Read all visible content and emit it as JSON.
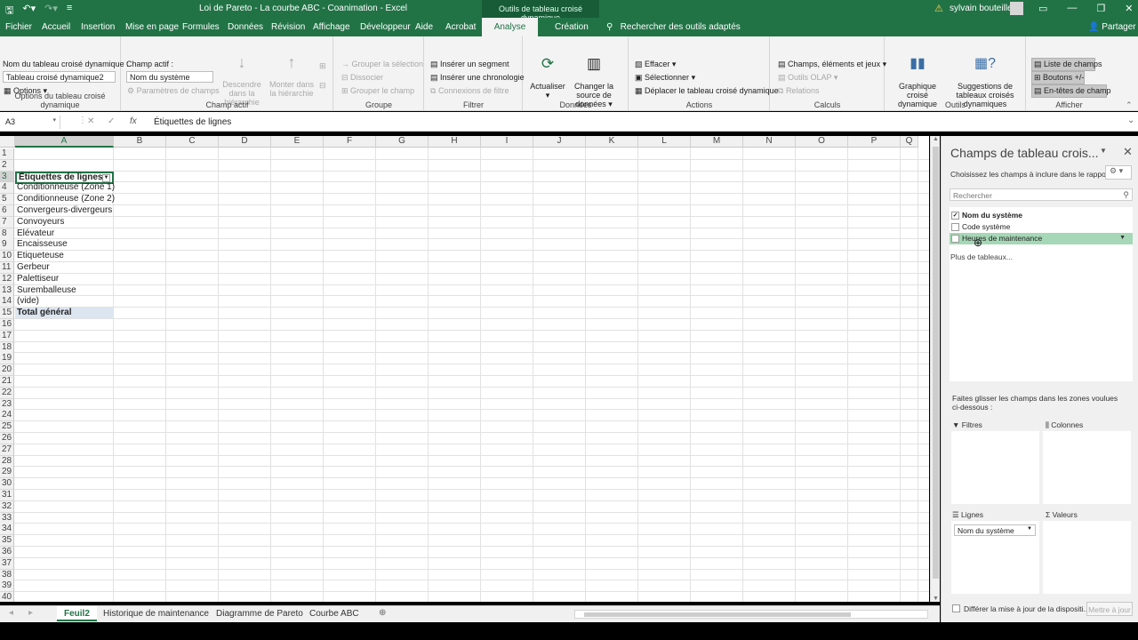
{
  "window": {
    "title": "Loi de Pareto - La courbe ABC - Coanimation  -  Excel",
    "context_title": "Outils de tableau croisé dynamique",
    "user": "sylvain bouteiller"
  },
  "tabs": [
    "Fichier",
    "Accueil",
    "Insertion",
    "Mise en page",
    "Formules",
    "Données",
    "Révision",
    "Affichage",
    "Développeur",
    "Aide",
    "Acrobat",
    "Analyse",
    "Création"
  ],
  "active_tab": "Analyse",
  "tell_me": "Rechercher des outils adaptés",
  "share": "Partager",
  "ribbon": {
    "pivot_options": {
      "name_label": "Nom du tableau croisé dynamique :",
      "name_value": "Tableau croisé dynamique2",
      "options_label": "Options",
      "group_label": "Options du tableau croisé dynamique"
    },
    "active_field": {
      "label": "Champ actif :",
      "value": "Nom du système",
      "field_settings": "Paramètres de champs",
      "drill_down": "Descendre dans la hiérarchie",
      "drill_up": "Monter dans la hiérarchie",
      "group_label": "Champ actif"
    },
    "group": {
      "group_selection": "Grouper la sélection",
      "ungroup": "Dissocier",
      "group_field": "Grouper le champ",
      "group_label": "Groupe"
    },
    "filter": {
      "insert_slicer": "Insérer un segment",
      "insert_timeline": "Insérer une chronologie",
      "filter_connections": "Connexions de filtre",
      "group_label": "Filtrer"
    },
    "data": {
      "refresh": "Actualiser",
      "change_source": "Changer la source de données",
      "group_label": "Données"
    },
    "actions": {
      "clear": "Effacer",
      "select": "Sélectionner",
      "move": "Déplacer le tableau croisé dynamique",
      "group_label": "Actions"
    },
    "calculations": {
      "fields_items": "Champs, éléments et jeux",
      "olap_tools": "Outils OLAP",
      "relationships": "Relations",
      "group_label": "Calculs"
    },
    "tools": {
      "pivot_chart": "Graphique croisé dynamique",
      "recommended": "Suggestions de tableaux croisés dynamiques",
      "group_label": "Outils"
    },
    "show": {
      "field_list": "Liste de champs",
      "buttons": "Boutons +/-",
      "field_headers": "En-têtes de champ",
      "group_label": "Afficher"
    }
  },
  "formula_bar": {
    "name_box": "A3",
    "cancel": "✕",
    "enter": "✓",
    "fx": "fx",
    "value": "Étiquettes de lignes"
  },
  "grid": {
    "columns": [
      "A",
      "B",
      "C",
      "D",
      "E",
      "F",
      "G",
      "H",
      "I",
      "J",
      "K",
      "L",
      "M",
      "N",
      "O",
      "P",
      "Q"
    ],
    "rows": [
      "1",
      "2",
      "3",
      "4",
      "5",
      "6",
      "7",
      "8",
      "9",
      "10",
      "11",
      "12",
      "13",
      "14",
      "15",
      "16",
      "17",
      "18",
      "19",
      "20",
      "21",
      "22",
      "23",
      "24",
      "25",
      "26",
      "27",
      "28",
      "29",
      "30",
      "31",
      "32",
      "33",
      "34",
      "35",
      "36",
      "37",
      "38",
      "39",
      "40"
    ],
    "header_cell": "Étiquettes de lignes",
    "items": [
      "Conditionneuse (Zone 1)",
      "Conditionneuse (Zone 2)",
      "Convergeurs-divergeurs",
      "Convoyeurs",
      "Elévateur",
      "Encaisseuse",
      "Etiqueteuse",
      "Gerbeur",
      "Palettiseur",
      "Suremballeuse",
      "(vide)"
    ],
    "total": "Total général"
  },
  "sheets": [
    "Feuil2",
    "Historique de maintenance",
    "Diagramme de Pareto",
    "Courbe ABC"
  ],
  "active_sheet": "Feuil2",
  "pane": {
    "title": "Champs de tableau crois...",
    "subtitle": "Choisissez les champs à inclure dans le rapport :",
    "search_placeholder": "Rechercher",
    "fields": [
      {
        "label": "Nom du système",
        "checked": true
      },
      {
        "label": "Code système",
        "checked": false
      },
      {
        "label": "Heures de maintenance",
        "checked": false
      }
    ],
    "more_tables": "Plus de tableaux...",
    "drag_hint": "Faites glisser les champs dans les zones voulues ci-dessous :",
    "zones": {
      "filters": "Filtres",
      "columns": "Colonnes",
      "rows": "Lignes",
      "values": "Valeurs"
    },
    "rows_item": "Nom du système",
    "defer": "Différer la mise à jour de la dispositi...",
    "update": "Mettre à jour"
  }
}
